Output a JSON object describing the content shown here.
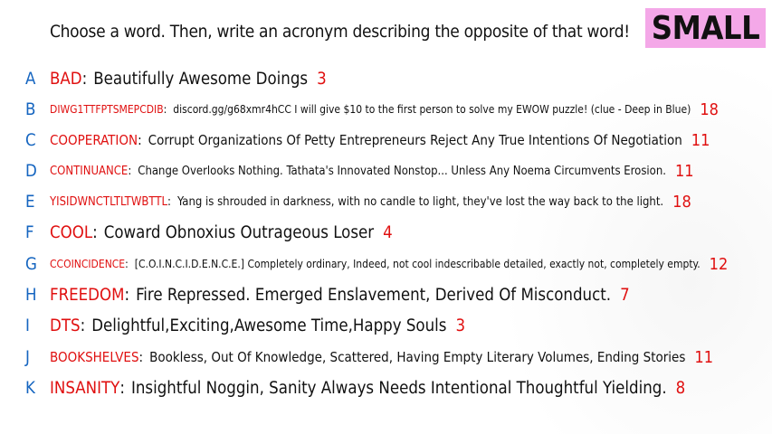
{
  "prompt": "Choose a word. Then, write an acronym describing the opposite of that word!",
  "badge": "SMALL",
  "entries": [
    {
      "letter": "A",
      "word": "BAD",
      "acronym": "Beautifully Awesome Doings",
      "score": "3"
    },
    {
      "letter": "B",
      "word": "DIWG1TTFPTSMEPCDIB",
      "acronym": "discord.gg/g68xmr4hCC  I will give $10 to the first person to solve my EWOW puzzle! (clue - Deep in Blue)",
      "score": "18"
    },
    {
      "letter": "C",
      "word": "COOPERATION",
      "acronym": "Corrupt Organizations Of Petty Entrepreneurs Reject Any True Intentions Of Negotiation",
      "score": "11"
    },
    {
      "letter": "D",
      "word": "CONTINUANCE",
      "acronym": "Change Overlooks Nothing. Tathata's Innovated Nonstop... Unless Any Noema Circumvents Erosion.",
      "score": "11"
    },
    {
      "letter": "E",
      "word": "YISIDWNCTLTLTWBTTL",
      "acronym": "Yang is shrouded in darkness, with no candle to light, they've lost the way back to the light.",
      "score": "18"
    },
    {
      "letter": "F",
      "word": "COOL",
      "acronym": "Coward Obnoxius Outrageous Loser",
      "score": "4"
    },
    {
      "letter": "G",
      "word": "CCOINCIDENCE",
      "acronym": "[C.O.I.N.C.I.D.E.N.C.E.] Completely ordinary, Indeed, not cool indescribable detailed, exactly not, completely empty.",
      "score": "12"
    },
    {
      "letter": "H",
      "word": "FREEDOM",
      "acronym": "Fire Repressed. Emerged Enslavement, Derived Of Misconduct.",
      "score": "7"
    },
    {
      "letter": "I",
      "word": "DTS",
      "acronym": "Delightful,Exciting,Awesome Time,Happy Souls",
      "score": "3"
    },
    {
      "letter": "J",
      "word": "BOOKSHELVES",
      "acronym": "Bookless, Out Of Knowledge, Scattered, Having Empty Literary Volumes, Ending Stories",
      "score": "11"
    },
    {
      "letter": "K",
      "word": "INSANITY",
      "acronym": "Insightful Noggin, Sanity Always Needs Intentional Thoughtful Yielding.",
      "score": "8"
    }
  ]
}
